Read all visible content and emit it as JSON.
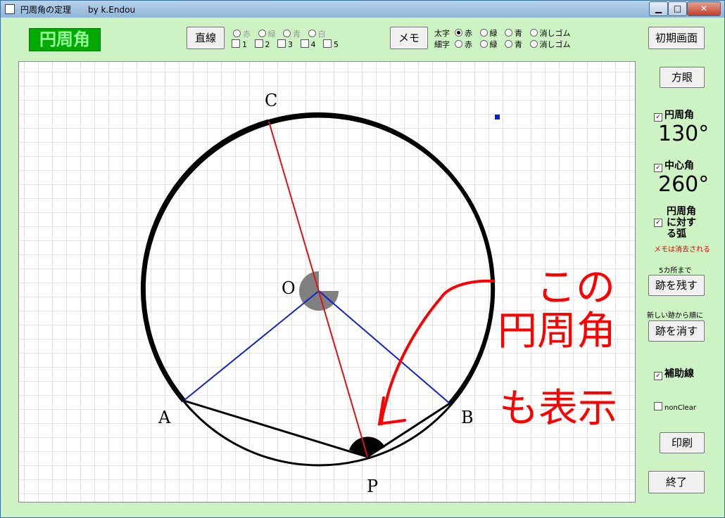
{
  "window": {
    "title": "円周角の定理　　by k.Endou",
    "minimize": "▁",
    "maximize": "□",
    "close": "✕"
  },
  "toolbar": {
    "badge": "円周角",
    "line_button": "直線",
    "line_colors": [
      "赤",
      "緑",
      "青",
      "白"
    ],
    "line_checks": [
      "1",
      "2",
      "3",
      "4",
      "5"
    ],
    "memo_button": "メモ",
    "thick_label": "太字",
    "thin_label": "細字",
    "pen_colors": [
      "赤",
      "緑",
      "青",
      "消しゴム"
    ],
    "reset_button": "初期画面"
  },
  "sidebar": {
    "grid_button": "方眼",
    "inscribed_label": "円周角",
    "inscribed_value": "130°",
    "central_label": "中心角",
    "central_value": "260°",
    "arc_label_1": "円周角",
    "arc_label_2": "に対す",
    "arc_label_3": "る弧",
    "memo_warning": "メモは消去される",
    "trace_limit": "5カ所まで",
    "keep_trace_button": "跡を残す",
    "erase_order": "新しい跡から順に",
    "erase_trace_button": "跡を消す",
    "aux_line_label": "補助線",
    "nonclear_label": "nonClear",
    "print_button": "印刷",
    "exit_button": "終了"
  },
  "figure": {
    "points": {
      "C": "C",
      "O": "O",
      "A": "A",
      "B": "B",
      "P": "P"
    },
    "annotation": [
      "この",
      "円周角",
      "も表示"
    ],
    "colors": {
      "red": "#e01010",
      "blue": "#1020d0",
      "memo": "#ff0000",
      "grid": "#c8c8c8"
    }
  }
}
